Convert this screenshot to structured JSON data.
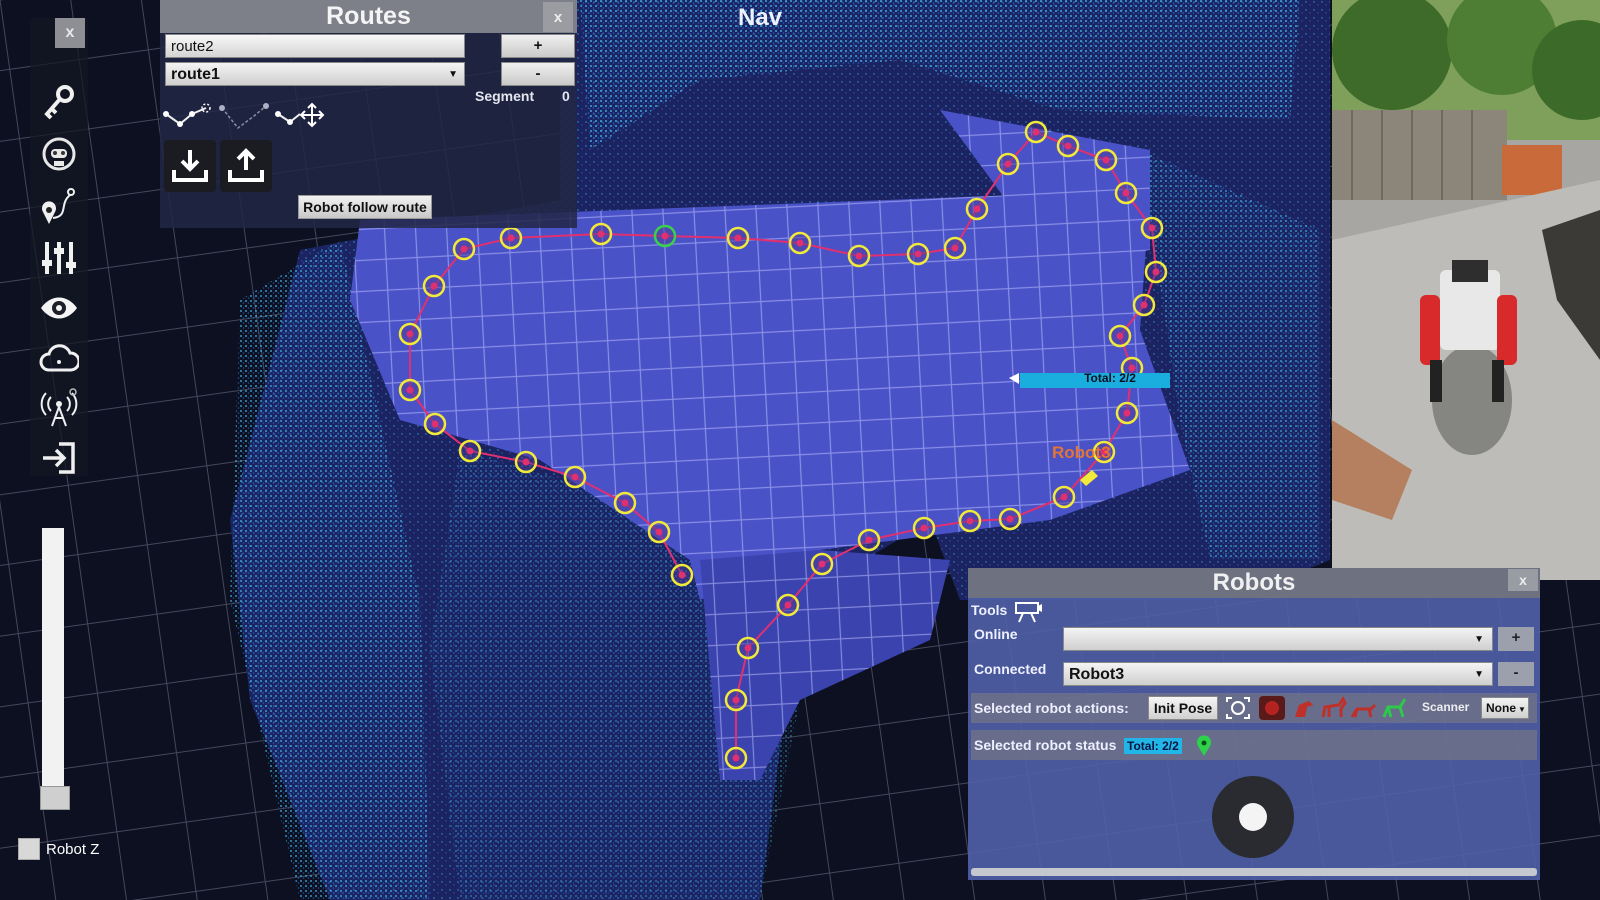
{
  "nav": {
    "title": "Nav"
  },
  "left_toolbar": {
    "close_label": "x",
    "items": [
      "key-icon",
      "robot-icon",
      "route-pin-icon",
      "sliders-icon",
      "eye-icon",
      "cloud-icon",
      "antenna-icon",
      "login-icon"
    ]
  },
  "z_control": {
    "label": "Robot Z",
    "checked": false
  },
  "routes": {
    "title": "Routes",
    "close_label": "x",
    "name_input": "route2",
    "selected_route": "route1",
    "add_label": "+",
    "remove_label": "-",
    "segment_label": "Segment",
    "segment_value": "0",
    "follow_button": "Robot follow route"
  },
  "map": {
    "progress_label": "Total: 2/2",
    "progress_fraction": 1.0,
    "robot_label": "Robot3",
    "colors": {
      "waypoint": "#f2ea3a",
      "active_waypoint": "#38d24a",
      "path": "#e03070",
      "progress": "#1aaede"
    }
  },
  "robots": {
    "title": "Robots",
    "close_label": "x",
    "tools_label": "Tools",
    "online_label": "Online",
    "online_value": "",
    "connected_label": "Connected",
    "connected_value": "Robot3",
    "add_label": "+",
    "remove_label": "-",
    "actions_label": "Selected robot actions:",
    "init_pose_label": "Init Pose",
    "scanner_label": "Scanner",
    "scanner_value": "None",
    "status_label": "Selected robot status",
    "status_badge": "Total: 2/2"
  }
}
